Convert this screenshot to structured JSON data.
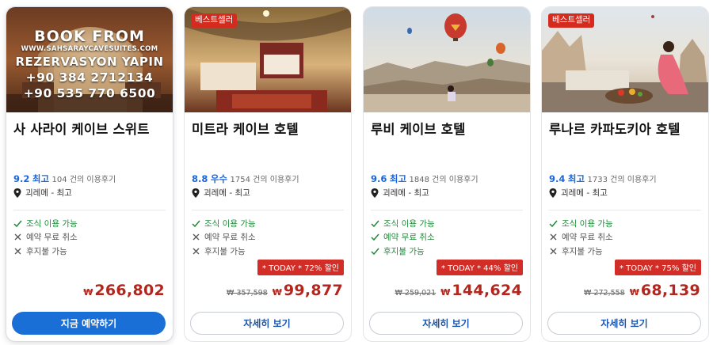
{
  "cards": [
    {
      "photo": "cave-suite-interior-photo",
      "badge": "",
      "promo": {
        "line1": "BOOK FROM",
        "line2": "WWW.SAHSARAYCAVESUITES.COM",
        "line3": "REZERVASYON YAPIN",
        "line4": "+90 384 2712134",
        "line5": "+90 535 770 6500"
      },
      "name": "사 사라이 케이브 스위트",
      "score": "9.2",
      "rating_word": "최고",
      "review_count": "104 건의 이용후기",
      "location": "괴레메 - 최고",
      "features": [
        {
          "text": "조식 이용 가능",
          "available": true
        },
        {
          "text": "예약 무료 취소",
          "available": false
        },
        {
          "text": "후지불 가능",
          "available": false
        }
      ],
      "sale_label": "",
      "old_price": "",
      "currency": "₩",
      "price": "266,802",
      "button": "지금 예약하기"
    },
    {
      "photo": "cave-hotel-bedroom-photo",
      "badge": "베스트셀러",
      "name": "미트라 케이브 호텔",
      "score": "8.8",
      "rating_word": "우수",
      "review_count": "1754 건의 이용후기",
      "location": "괴레메 - 최고",
      "features": [
        {
          "text": "조식 이용 가능",
          "available": true
        },
        {
          "text": "예약 무료 취소",
          "available": false
        },
        {
          "text": "후지불 가능",
          "available": false
        }
      ],
      "sale_label": "* TODAY * 72% 할인",
      "old_price": "₩ 357,598",
      "currency": "₩",
      "price": "99,877",
      "button": "자세히 보기"
    },
    {
      "photo": "balloons-terrace-photo",
      "badge": "",
      "name": "루비 케이브 호텔",
      "score": "9.6",
      "rating_word": "최고",
      "review_count": "1848 건의 이용후기",
      "location": "괴레메 - 최고",
      "features": [
        {
          "text": "조식 이용 가능",
          "available": true
        },
        {
          "text": "예약 무료 취소",
          "available": true
        },
        {
          "text": "후지불 가능",
          "available": true
        }
      ],
      "sale_label": "* TODAY * 44% 할인",
      "old_price": "₩ 259,021",
      "currency": "₩",
      "price": "144,624",
      "button": "자세히 보기"
    },
    {
      "photo": "terrace-breakfast-balloons-photo",
      "badge": "베스트셀러",
      "name": "루나르 카파도키아 호텔",
      "score": "9.4",
      "rating_word": "최고",
      "review_count": "1733 건의 이용후기",
      "location": "괴레메 - 최고",
      "features": [
        {
          "text": "조식 이용 가능",
          "available": true
        },
        {
          "text": "예약 무료 취소",
          "available": false
        },
        {
          "text": "후지불 가능",
          "available": false
        }
      ],
      "sale_label": "* TODAY * 75% 할인",
      "old_price": "₩ 272,558",
      "currency": "₩",
      "price": "68,139",
      "button": "자세히 보기"
    }
  ],
  "icons": {
    "location": "map-pin-icon",
    "available": "check-icon",
    "unavailable": "x-icon"
  },
  "colors": {
    "accent": "#1a6fd6",
    "rating": "#1c66d9",
    "price": "#b3261e",
    "badge": "#d52b1e",
    "available": "#1e8a3a"
  }
}
